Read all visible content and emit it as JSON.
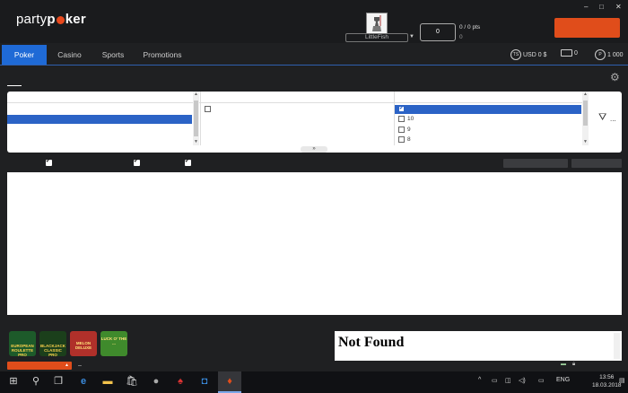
{
  "header": {
    "logo_part1": "party",
    "logo_part2": "p",
    "logo_part3": "ker",
    "username": "LittleFish",
    "points_value": "0",
    "points_label": "0 / 0 pts",
    "points_sub": "0",
    "window_controls": [
      "–",
      "□",
      "✕"
    ]
  },
  "nav": {
    "tabs": [
      "Poker",
      "Casino",
      "Sports",
      "Promotions"
    ],
    "active_tab": "Poker",
    "balance_icon": "TS",
    "balance_label": "USD 0 $",
    "tickets_count": "0",
    "points_icon": "P",
    "points_count": "1 000"
  },
  "filters": {
    "col3_options": [
      "10",
      "9",
      "8"
    ],
    "collapse_glyph": "»"
  },
  "bottom": {
    "games": [
      {
        "name": "EUROPEAN ROULETTE PRO",
        "bg": "#1d5a2a"
      },
      {
        "name": "BLACKJACK CLASSIC PRO",
        "bg": "#1b3f1b"
      },
      {
        "name": "MELON DELUXE",
        "bg": "#b0302a"
      },
      {
        "name": "LUCK O' THE ...",
        "bg": "#3f8a2c"
      }
    ],
    "notfound_text": "Not Found",
    "dash": "–"
  },
  "taskbar": {
    "language": "ENG",
    "time": "13:56",
    "date": "18.03.2018"
  },
  "colors": {
    "accent_blue": "#1f6ad6",
    "brand_orange": "#e04d1b"
  }
}
